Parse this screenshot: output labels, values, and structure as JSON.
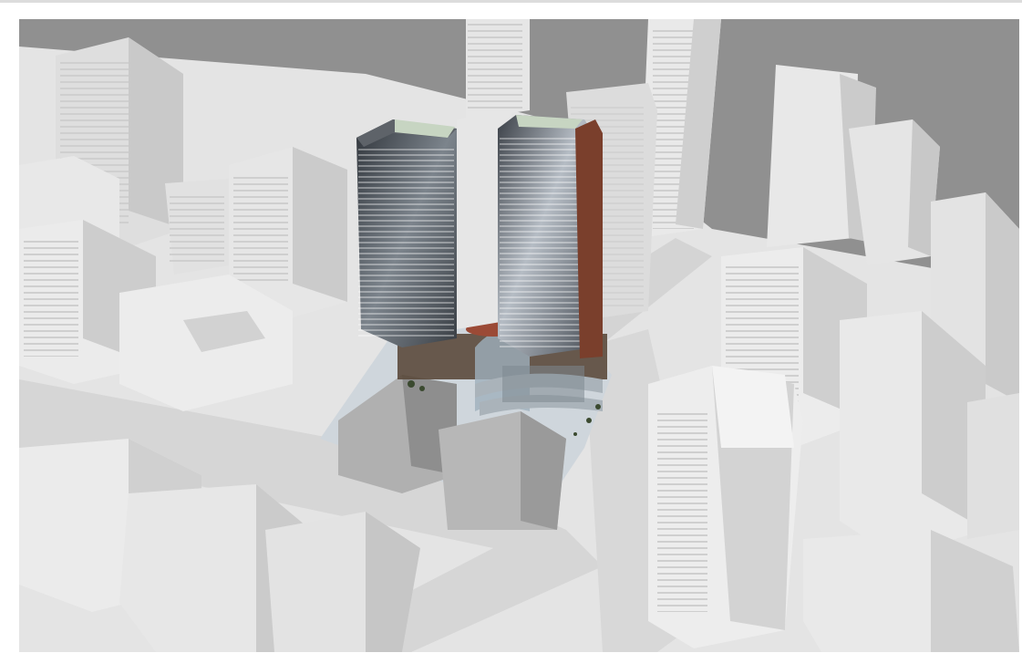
{
  "image": {
    "kind": "architectural massing rendering",
    "palette": {
      "sky": "#8f8f8f",
      "massing": "#e9e9e9",
      "massing_shadow": "#cfcfcf",
      "road": "#d9d9d9",
      "tower_glass": "#3e434a",
      "tower_glass_light": "#aeb4bb",
      "podium_brick": "#5b4a3c",
      "accent_copper": "#7a3f2c",
      "roof_green": "#c7d5c2"
    }
  }
}
